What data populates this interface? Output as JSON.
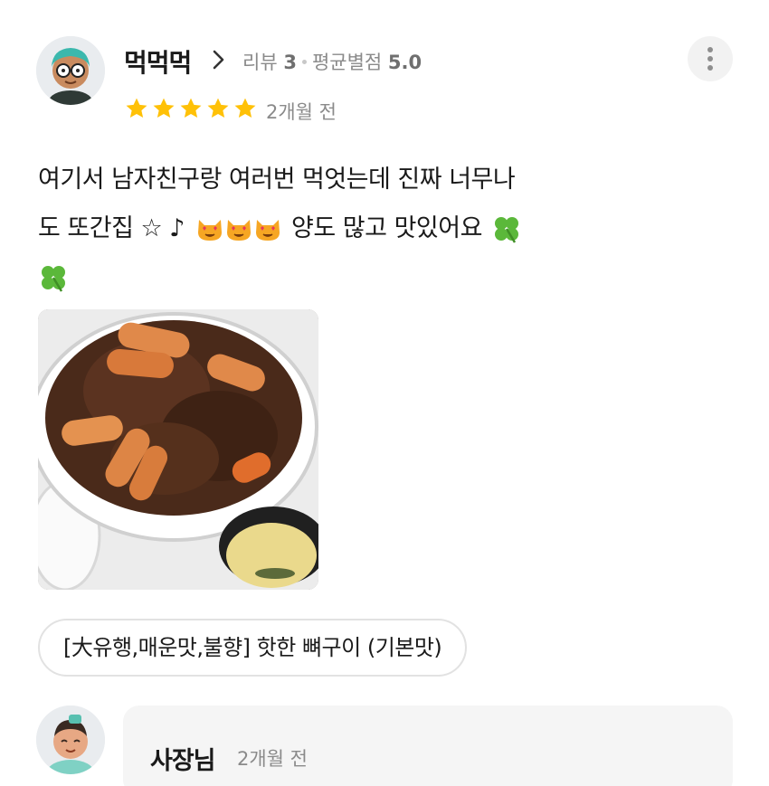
{
  "review": {
    "reviewer_name": "먹먹먹",
    "review_count_label": "리뷰",
    "review_count": "3",
    "avg_rating_label": "평균별점",
    "avg_rating": "5.0",
    "rating": 5,
    "date": "2개월 전",
    "text_line1": "여기서 남자친구랑 여러번 먹엇는데 진짜 너무나",
    "text_line2a": "도 또간집 ☆ ♪",
    "text_line2b": "양도 많고 맛있어요",
    "menu_tag": "[大유행,매운맛,불향] 핫한 뼈구이 (기본맛)"
  },
  "owner_reply": {
    "name": "사장님",
    "date": "2개월 전"
  },
  "icons": {
    "more": "more-vertical-icon",
    "chevron": "chevron-right-icon",
    "star": "star-icon",
    "cat": "heart-eyes-cat-emoji",
    "clover": "four-leaf-clover-emoji"
  },
  "colors": {
    "star": "#FFC107",
    "muted_text": "#8a8a8a",
    "bubble_bg": "#f5f5f5"
  }
}
